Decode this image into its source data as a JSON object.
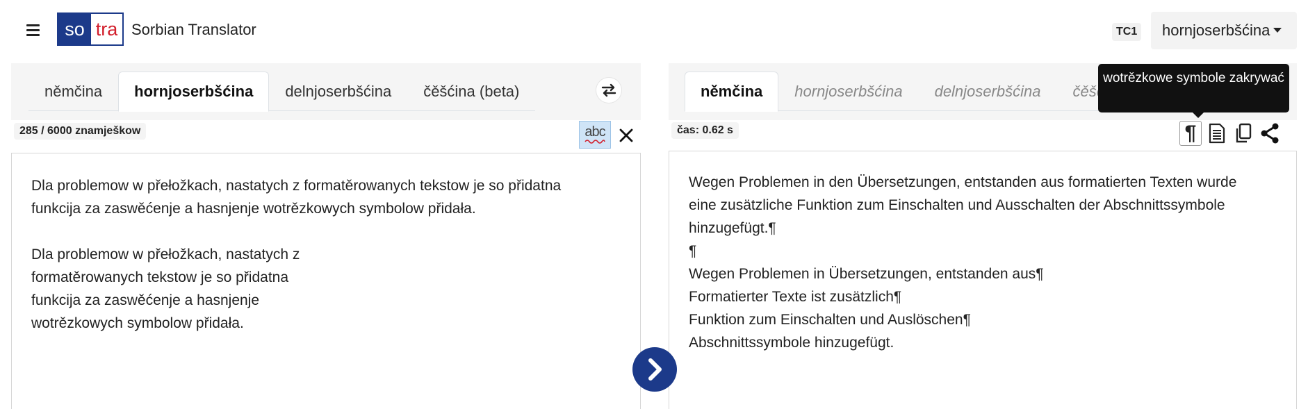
{
  "header": {
    "menu_icon": "hamburger-icon",
    "logo_so": "so",
    "logo_tra": "tra",
    "title": "Sorbian Translator",
    "badge": "TC1",
    "ui_language": "hornjoserbšćina"
  },
  "source": {
    "tabs": [
      "němčina",
      "hornjoserbšćina",
      "delnjoserbšćina",
      "čěšćina (beta)"
    ],
    "active_tab": "hornjoserbšćina",
    "char_counter": "285 / 6000 znamješkow",
    "spellcheck_label": "abc",
    "text": "Dla problemow w přełožkach, nastatych z formatěrowanych tekstow je so přidatna\nfunkcija za zaswěćenje a hasnjenje wotrězkowych symbolow přidała.\n\nDla problemow w přełožkach, nastatych z\nformatěrowanych tekstow je so přidatna\nfunkcija za zaswěćenje a hasnjenje\nwotrězkowych symbolow přidała."
  },
  "target": {
    "tabs": [
      "němčina",
      "hornjoserbšćina",
      "delnjoserbšćina",
      "čěšćina (beta)"
    ],
    "active_tab": "němčina",
    "time": "čas: 0.62 s",
    "pilcrow_glyph": "¶",
    "tooltip": "wotrězkowe symbole zakrywać",
    "text": "Wegen Problemen in den Übersetzungen, entstanden aus formatierten Texten wurde\neine zusätzliche Funktion zum Einschalten und Ausschalten der Abschnittssymbole\nhinzugefügt.¶\n¶\nWegen Problemen in Übersetzungen, entstanden aus¶\nFormatierter Texte ist zusätzlich¶\nFunktion zum Einschalten und Auslöschen¶\nAbschnittssymbole hinzugefügt."
  },
  "colors": {
    "brand_blue": "#1c3a8a",
    "brand_red": "#d21d2a",
    "tooltip_bg": "#111111"
  }
}
